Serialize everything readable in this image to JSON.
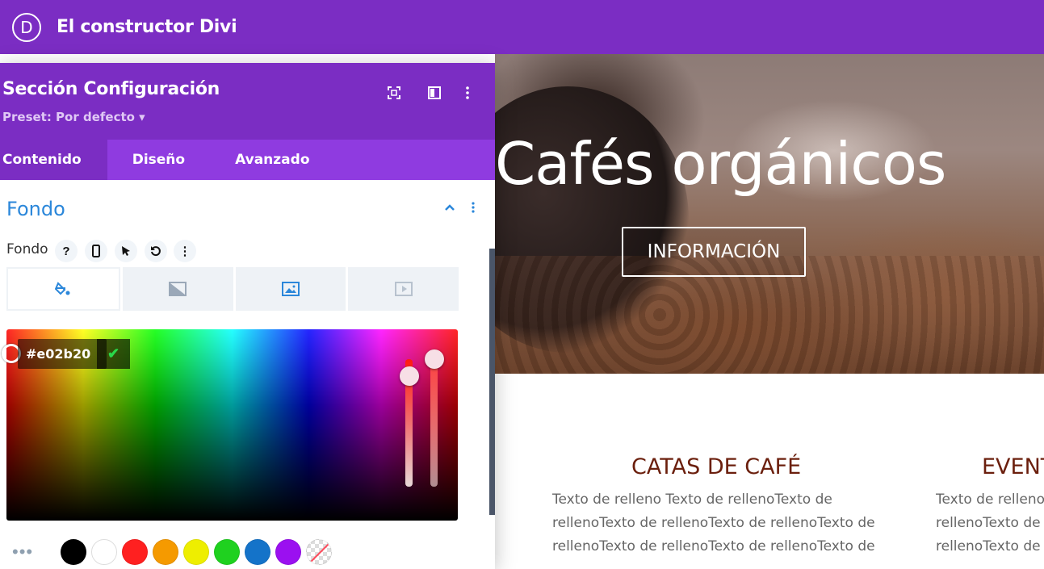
{
  "app": {
    "logo_letter": "D",
    "title": "El constructor Divi",
    "accent": "#7b2dc3"
  },
  "panel": {
    "title": "Sección Configuración",
    "preset": "Preset: Por defecto ▾",
    "tabs": [
      {
        "label": "Contenido",
        "active": true
      },
      {
        "label": "Diseño",
        "active": false
      },
      {
        "label": "Avanzado",
        "active": false
      }
    ],
    "section_title": "Fondo",
    "field_label": "Fondo",
    "field_buttons": [
      "?",
      "☐",
      "➤",
      "↺",
      "⋮"
    ],
    "bg_types": [
      "paint-bucket-icon",
      "gradient-icon",
      "image-icon",
      "video-icon"
    ],
    "color": {
      "hex": "#e02b20",
      "check": "✔"
    },
    "swatches": [
      "#000000",
      "#ffffff",
      "#ff2020",
      "#f59a00",
      "#eeee00",
      "#1fd11f",
      "#1473c9",
      "#9b10f0",
      "none"
    ],
    "more": "•••"
  },
  "page": {
    "hero_title": "Cafés orgánicos",
    "hero_button": "INFORMACIÓN",
    "columns": [
      {
        "title": "CATAS DE CAFÉ",
        "text": [
          "Texto de relleno Texto de rellenoTexto de",
          "rellenoTexto de rellenoTexto de rellenoTexto de",
          "rellenoTexto de rellenoTexto de rellenoTexto de"
        ]
      },
      {
        "title": "EVENT",
        "text": [
          "Texto de relleno",
          "rellenoTexto de r",
          "rellenoTexto de r"
        ]
      }
    ]
  }
}
